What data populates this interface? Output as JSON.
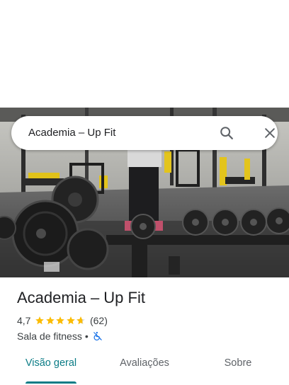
{
  "search": {
    "query": "Academia – Up Fit",
    "search_icon": "search-icon",
    "close_icon": "close-icon"
  },
  "place": {
    "name": "Academia – Up Fit",
    "rating": "4,7",
    "rating_numeric": 4.7,
    "review_count": "(62)",
    "category": "Sala de fitness",
    "separator": "•",
    "accessibility_icon": "wheelchair-not-accessible-icon"
  },
  "tabs": [
    {
      "label": "Visão geral",
      "active": true
    },
    {
      "label": "Avaliações",
      "active": false
    },
    {
      "label": "Sobre",
      "active": false
    }
  ],
  "colors": {
    "accent": "#0b7c86",
    "star": "#fbbc04",
    "accessibility_icon": "#1a73e8",
    "text_primary": "#202124",
    "text_secondary": "#5f6368"
  }
}
